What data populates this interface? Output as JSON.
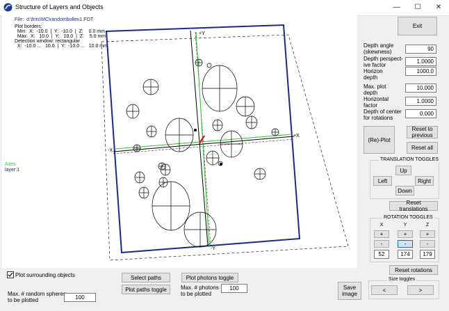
{
  "window": {
    "title": "Structure of Layers and Objects",
    "minimize": "—",
    "maximize": "☐",
    "close": "✕"
  },
  "info": {
    "file_label": "File:",
    "file_path": "d:\\frits\\MC\\randombollen1.FOT",
    "plot_borders": "Plot borders:",
    "min_line": "  Min:  X:  -10.0  |  Y:  -10.0  |  Z:    0.0 mm",
    "max_line": "  Max:  X:   10.0  |  Y:   10.0  |  Z:    5.0 mm",
    "detection_window": "Detection window: rectangular",
    "detection_range": "  X:  -10.0 ...   10.0  |  Y:  -10.0 ...   10.0 mm"
  },
  "legend": {
    "axes": "Axes",
    "layer": "layer 1"
  },
  "axis_labels": {
    "plus_y": "+Y",
    "minus_y": "-Y",
    "plus_x": "+X",
    "minus_x": "-X"
  },
  "panel": {
    "exit": "Exit",
    "depth_angle_label": "Depth angle\n(skewness)",
    "depth_angle_value": "90",
    "depth_persp_label": "Depth perspect-\nive factor",
    "depth_persp_value": "1.0000",
    "horizon_label": "Horizon\ndepth",
    "horizon_value": "1000.0",
    "max_plot_label": "Max. plot\ndepth",
    "max_plot_value": "10.000",
    "horiz_factor_label": "Horizontal\nfactor",
    "horiz_factor_value": "1.0000",
    "center_depth_label": "Depth of center\nfor rotations",
    "center_depth_value": "0.000",
    "replot": "(Re)-Plot",
    "reset_previous": "Reset to\nprevious",
    "reset_all": "Reset all",
    "translation_title": "TRANSLATION TOGGLES",
    "up": "Up",
    "left": "Left",
    "right": "Right",
    "down": "Down",
    "reset_translations": "Reset translations",
    "rotation_title": "ROTATION TOGGLES",
    "x": "X",
    "y": "Y",
    "z": "Z",
    "plus": "+",
    "minus": "-",
    "rot_x": "52",
    "rot_y": "174",
    "rot_z": "179",
    "reset_rotations": "Reset rotations",
    "size_title": "Size toggles",
    "size_less": "<",
    "size_more": ">"
  },
  "bottom": {
    "plot_surrounding": "Plot surrounding objects",
    "max_spheres_label": "Max. # random spheres\nto be plotted",
    "max_spheres_value": "100",
    "select_paths": "Select paths",
    "plot_paths_toggle": "Plot paths toggle",
    "plot_photons_toggle": "Plot photons toggle",
    "max_photons_label": "Max. # photons\nto be plotted",
    "max_photons_value": "100",
    "save_image": "Save\nimage"
  },
  "colors": {
    "layer_blue": "#1a2a8c",
    "axis_green": "#2fbf2f",
    "photon_red": "#d02020"
  }
}
